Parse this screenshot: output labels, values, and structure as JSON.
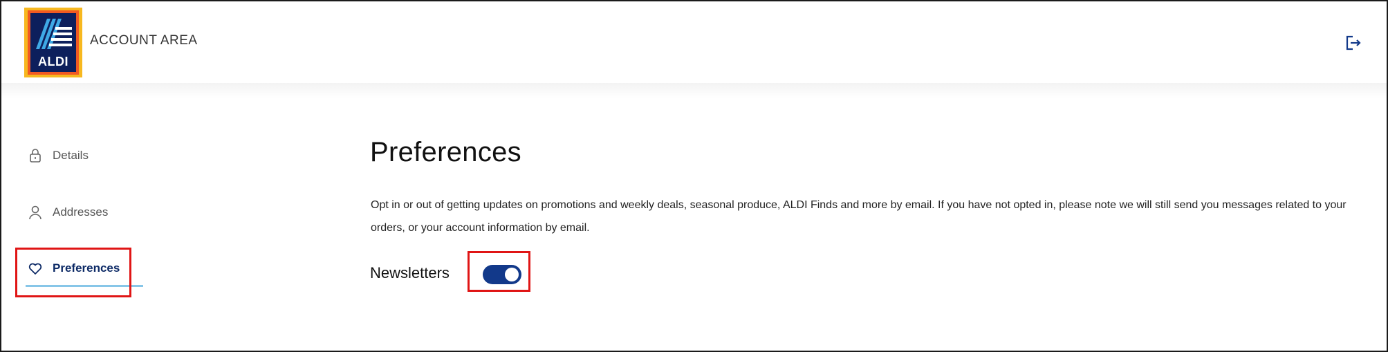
{
  "header": {
    "logo_text": "ALDI",
    "title": "ACCOUNT AREA",
    "logout_icon": "logout-icon"
  },
  "sidebar": {
    "items": [
      {
        "label": "Details",
        "icon": "lock-icon",
        "active": false
      },
      {
        "label": "Addresses",
        "icon": "user-icon",
        "active": false
      },
      {
        "label": "Preferences",
        "icon": "heart-icon",
        "active": true
      }
    ]
  },
  "main": {
    "title": "Preferences",
    "description": "Opt in or out of getting updates on promotions and weekly deals, seasonal produce, ALDI Finds and more by email. If you have not opted in, please note we will still send you messages related to your orders, or your account information by email.",
    "newsletter": {
      "label": "Newsletters",
      "enabled": true
    }
  },
  "colors": {
    "brand_navy": "#0d1f5c",
    "toggle_on": "#12398a",
    "active_underline": "#87c6e8",
    "highlight_red": "#e01515"
  }
}
